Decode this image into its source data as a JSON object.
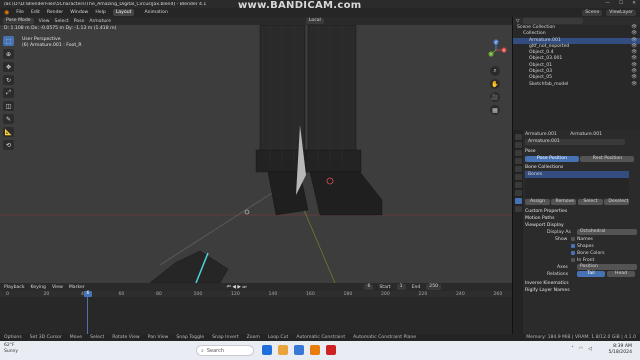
{
  "window": {
    "title": "/as [D:\\D:\\BlenderFiles\\5Characters\\The_Amazing_Digital_Circus\\Jax.blend] - Blender 4.1",
    "controls": [
      "—",
      "☐",
      "✕"
    ]
  },
  "watermark": "www.BANDICAM.com",
  "menubar": {
    "items": [
      "File",
      "Edit",
      "Render",
      "Window",
      "Help"
    ],
    "workspaces": [
      {
        "label": "Layout",
        "active": true
      },
      {
        "label": "Animation",
        "active": false
      }
    ],
    "scene": "Scene",
    "view_layer": "ViewLayer"
  },
  "viewport_header": {
    "mode": "Pose Mode",
    "menus": [
      "View",
      "Select",
      "Pose",
      "Armature"
    ],
    "transform_orientation": "Local"
  },
  "viewport": {
    "info_line1": "User Perspective",
    "info_line2": "(6) Armature.001 : Foot_R",
    "top_info": "D: 1.108 m  Dx: -0.0575 m  Dy: -1.13 m  (1.418 m)"
  },
  "toolbar": {
    "tools": [
      {
        "name": "select-box-icon",
        "glyph": "⬚",
        "active": true
      },
      {
        "name": "cursor-icon",
        "glyph": "⊕",
        "active": false
      },
      {
        "name": "move-icon",
        "glyph": "✥",
        "active": false
      },
      {
        "name": "rotate-icon",
        "glyph": "↻",
        "active": false
      },
      {
        "name": "scale-icon",
        "glyph": "⤢",
        "active": false
      },
      {
        "name": "transform-icon",
        "glyph": "◫",
        "active": false
      },
      {
        "name": "annotate-icon",
        "glyph": "✎",
        "active": false
      },
      {
        "name": "measure-icon",
        "glyph": "📐",
        "active": false
      },
      {
        "name": "bone-roll-icon",
        "glyph": "⟲",
        "active": false
      }
    ]
  },
  "navigation": {
    "axes": {
      "x": "X",
      "y": "Y",
      "z": "Z"
    },
    "buttons": [
      "⌕",
      "✋",
      "🎥",
      "▦"
    ]
  },
  "timeline": {
    "menus": [
      "Playback",
      "Keying",
      "View",
      "Marker"
    ],
    "current_frame": "6",
    "start_label": "Start",
    "start": "1",
    "end_label": "End",
    "end": "250",
    "ticks": [
      "0",
      "20",
      "40",
      "60",
      "80",
      "100",
      "120",
      "140",
      "160",
      "180",
      "200",
      "220",
      "240",
      "260"
    ]
  },
  "outliner": {
    "title": "Scene Collection",
    "rows": [
      {
        "label": "Scene Collection",
        "indent": 0,
        "selected": false
      },
      {
        "label": "Collection",
        "indent": 1,
        "selected": false
      },
      {
        "label": "Armature.001",
        "indent": 2,
        "selected": true
      },
      {
        "label": "gltf_not_exported",
        "indent": 2,
        "selected": false
      },
      {
        "label": "Object_0.4",
        "indent": 2,
        "selected": false
      },
      {
        "label": "Object_03.001",
        "indent": 2,
        "selected": false
      },
      {
        "label": "Object_01",
        "indent": 2,
        "selected": false
      },
      {
        "label": "Object_03",
        "indent": 2,
        "selected": false
      },
      {
        "label": "Object_05",
        "indent": 2,
        "selected": false
      },
      {
        "label": "Sketchfab_model",
        "indent": 2,
        "selected": false
      }
    ]
  },
  "properties": {
    "breadcrumb": [
      "Armature.001",
      "Armature.001"
    ],
    "datablock": "Armature.001",
    "pose_section": "Pose",
    "pose_position": "Pose Position",
    "rest_position": "Rest Position",
    "bone_collections_section": "Bone Collections",
    "bone_collection_item": "Bones",
    "bc_buttons": [
      "Assign",
      "Remove",
      "Select",
      "Deselect"
    ],
    "custom_properties": "Custom Properties",
    "motion_paths": "Motion Paths",
    "viewport_display": "Viewport Display",
    "display_as_label": "Display As",
    "display_as_value": "Octahedral",
    "show_label": "Show",
    "show_options": [
      {
        "label": "Names",
        "checked": false
      },
      {
        "label": "Shapes",
        "checked": true
      },
      {
        "label": "Bone Colors",
        "checked": true
      },
      {
        "label": "In Front",
        "checked": false
      }
    ],
    "axes_label": "Axes",
    "axes_value": "Position",
    "relations_label": "Relations",
    "relations_tail": "Tail",
    "relations_head": "Head",
    "inverse_kinematics": "Inverse Kinematics",
    "rigify": "Rigify Layer Names"
  },
  "statusbar": {
    "items": [
      "Options",
      "Set 3D Cursor",
      "Move",
      "Select",
      "Rotate View",
      "Pan View",
      "Snap Toggle",
      "Snap Invert",
      "Zoom",
      "Loop Cut",
      "Automatic Constraint",
      "Automatic Constraint Plane"
    ],
    "version": "Memory: 184.9 MiB | VRAM: 1.8/12.0 GiB | 4.1.0"
  },
  "taskbar": {
    "weather_temp": "62°F",
    "weather_desc": "Sunny",
    "search_placeholder": "Search",
    "time": "8:39 AM",
    "date": "5/18/2024"
  },
  "colors": {
    "accent": "#4772b3",
    "viewport_bg": "#3d3d3d",
    "panel_bg": "#2b2b2b",
    "selected_row": "#334d80"
  }
}
